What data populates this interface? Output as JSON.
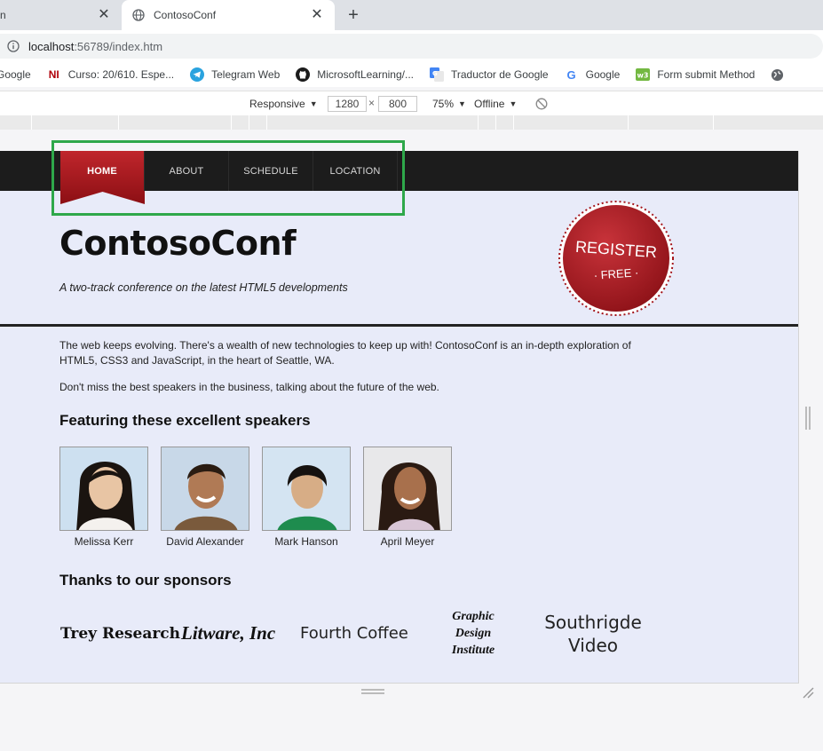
{
  "browser": {
    "tabs": [
      {
        "title": "n",
        "active": false
      },
      {
        "title": "ContosoConf",
        "active": true
      }
    ],
    "new_tab_label": "+",
    "close_label": "✕",
    "address": {
      "host": "localhost",
      "path": ":56789/index.htm"
    },
    "bookmarks": [
      {
        "label": "Google",
        "icon": "google-icon"
      },
      {
        "label": "Curso: 20/610. Espe...",
        "icon": "ni-icon"
      },
      {
        "label": "Telegram Web",
        "icon": "telegram-icon"
      },
      {
        "label": "MicrosoftLearning/...",
        "icon": "github-icon"
      },
      {
        "label": "Traductor de Google",
        "icon": "translate-icon"
      },
      {
        "label": "Google",
        "icon": "google-icon"
      },
      {
        "label": "Form submit Method",
        "icon": "w3-icon"
      }
    ]
  },
  "devtools": {
    "device": "Responsive",
    "width": "1280",
    "times": "×",
    "height": "800",
    "zoom": "75%",
    "throttle": "Offline"
  },
  "site": {
    "nav": [
      "HOME",
      "ABOUT",
      "SCHEDULE",
      "LOCATION"
    ],
    "title": "ContosoConf",
    "subtitle": "A two-track conference on the latest HTML5 developments",
    "register": {
      "line1": "REGISTER",
      "line2": "· FREE ·"
    },
    "intro": "The web keeps evolving. There's a wealth of new technologies to keep up with! ContosoConf is an in-depth exploration of HTML5, CSS3 and JavaScript, in the heart of Seattle, WA.",
    "intro2": "Don't miss the best speakers in the business, talking about the future of the web.",
    "speakers_heading": "Featuring these excellent speakers",
    "speakers": [
      "Melissa Kerr",
      "David Alexander",
      "Mark Hanson",
      "April Meyer"
    ],
    "sponsors_heading": "Thanks to our sponsors",
    "sponsors": [
      "Trey Research",
      "Litware, Inc",
      "Fourth Coffee",
      "Graphic Design Institute",
      "Southrigde Video"
    ]
  },
  "colors": {
    "nav_bg": "#1c1c1c",
    "accent": "#a5161c",
    "page_bg": "#e8ebf9",
    "highlight": "#2ea84a"
  }
}
